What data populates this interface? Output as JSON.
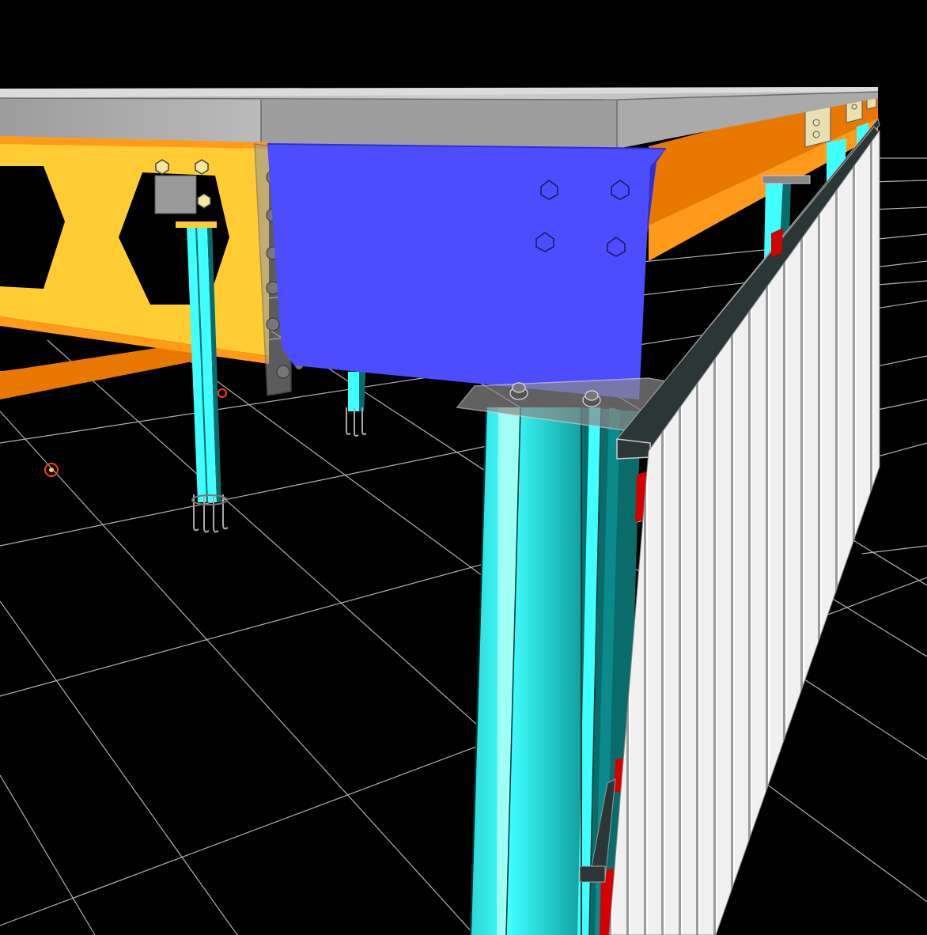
{
  "viewport": {
    "background": "#000000",
    "grid_color": "#d8d8d8"
  },
  "colors": {
    "slab_top": "#bdbdbd",
    "slab_side": "#8c8c8c",
    "cellular_beam": "#ffcc33",
    "cellular_beam_edge": "#ff9a1a",
    "edge_beam": "#e87800",
    "end_plate": "#4d4dff",
    "column": "#40ffff",
    "column_dark": "#0a6b6b",
    "cladding": "#f2f2f2",
    "cladding_shadow": "#7c7c7c",
    "rail": "#2b3636",
    "flashing": "#d40000",
    "grid_marker": "#ff3b1a"
  },
  "icons": {
    "bolt": "hex-bolt-icon",
    "grid_marker": "grid-point-marker-icon",
    "anchor": "anchor-bolt-icon"
  }
}
